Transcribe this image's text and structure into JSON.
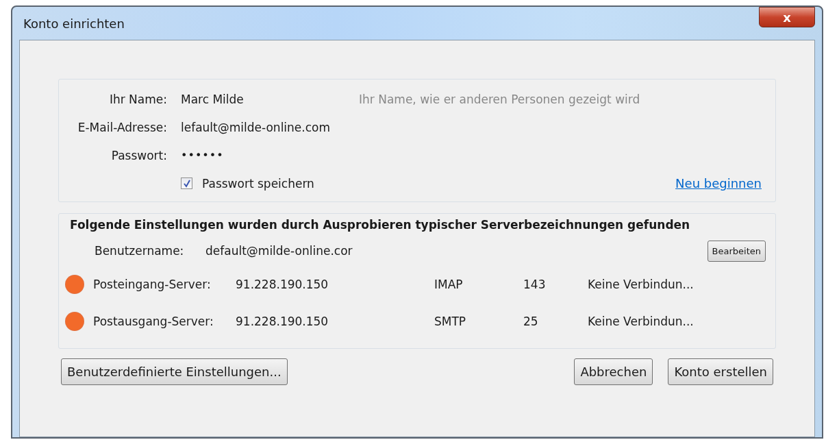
{
  "window": {
    "title": "Konto einrichten",
    "close_label": "x"
  },
  "identity": {
    "fields": [
      {
        "kind": "text",
        "label": "Ihr Name:",
        "value": "Marc Milde",
        "hint": "Ihr Name, wie er anderen Personen gezeigt wird"
      },
      {
        "kind": "text",
        "label": "E-Mail-Adresse:",
        "value": "lefault@milde-online.com"
      },
      {
        "kind": "password",
        "label": "Passwort:",
        "value": "••••••"
      }
    ],
    "remember": {
      "label": "Passwort speichern",
      "checked": true
    },
    "restart_link": "Neu beginnen"
  },
  "servers": {
    "heading": "Folgende Einstellungen wurden durch Ausprobieren typischer Serverbezeichnungen gefunden",
    "username_label": "Benutzername:",
    "username": "default@milde-online.cor",
    "edit_button": "Bearbeiten",
    "rows": [
      {
        "label": "Posteingang-Server:",
        "host": "91.228.190.150",
        "protocol": "IMAP",
        "port": "143",
        "status_text": "Keine Verbindun...",
        "color": "#f26a2a"
      },
      {
        "label": "Postausgang-Server:",
        "host": "91.228.190.150",
        "protocol": "SMTP",
        "port": "25",
        "status_text": "Keine Verbindun...",
        "color": "#f26a2a"
      }
    ]
  },
  "buttons": {
    "advanced": "Benutzerdefinierte Einstellungen...",
    "cancel": "Abbrechen",
    "create": "Konto erstellen"
  }
}
